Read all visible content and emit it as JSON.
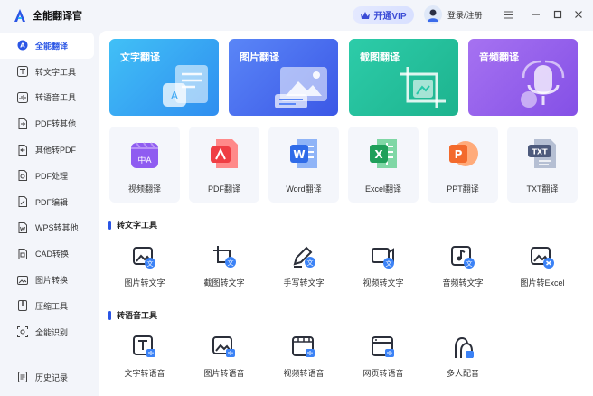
{
  "app": {
    "title": "全能翻译官"
  },
  "header": {
    "vip_label": "开通VIP",
    "login_label": "登录/注册"
  },
  "sidebar": {
    "items": [
      {
        "label": "全能翻译",
        "icon": "translate-icon"
      },
      {
        "label": "转文字工具",
        "icon": "text-tool-icon"
      },
      {
        "label": "转语音工具",
        "icon": "voice-tool-icon"
      },
      {
        "label": "PDF转其他",
        "icon": "pdf-convert-icon"
      },
      {
        "label": "其他转PDF",
        "icon": "to-pdf-icon"
      },
      {
        "label": "PDF处理",
        "icon": "pdf-process-icon"
      },
      {
        "label": "PDF编辑",
        "icon": "pdf-edit-icon"
      },
      {
        "label": "WPS转其他",
        "icon": "wps-icon"
      },
      {
        "label": "CAD转换",
        "icon": "cad-icon"
      },
      {
        "label": "图片转换",
        "icon": "image-convert-icon"
      },
      {
        "label": "压缩工具",
        "icon": "compress-icon"
      },
      {
        "label": "全能识别",
        "icon": "recognize-icon"
      }
    ],
    "bottom_label": "历史记录"
  },
  "big_cards": [
    {
      "label": "文字翻译",
      "color_from": "#3fb9f4",
      "color_to": "#2f8ef0"
    },
    {
      "label": "图片翻译",
      "color_from": "#4f7ef6",
      "color_to": "#3e5ae8"
    },
    {
      "label": "截图翻译",
      "color_from": "#27c7a8",
      "color_to": "#1eb38f"
    },
    {
      "label": "音频翻译",
      "color_from": "#a36cf0",
      "color_to": "#8450e6"
    }
  ],
  "file_cards": [
    {
      "label": "视频翻译",
      "icon": "video-translate-icon"
    },
    {
      "label": "PDF翻译",
      "icon": "pdf-translate-icon"
    },
    {
      "label": "Word翻译",
      "icon": "word-translate-icon"
    },
    {
      "label": "Excel翻译",
      "icon": "excel-translate-icon"
    },
    {
      "label": "PPT翻译",
      "icon": "ppt-translate-icon"
    },
    {
      "label": "TXT翻译",
      "icon": "txt-translate-icon"
    }
  ],
  "sections": {
    "text_tools": {
      "title": "转文字工具",
      "items": [
        "图片转文字",
        "截图转文字",
        "手写转文字",
        "视频转文字",
        "音频转文字",
        "图片转Excel"
      ]
    },
    "voice_tools": {
      "title": "转语音工具",
      "items": [
        "文字转语音",
        "图片转语音",
        "视频转语音",
        "网页转语音",
        "多人配音"
      ]
    }
  },
  "icons": {
    "file_badges": {
      "word": "W",
      "excel": "X",
      "ppt": "P",
      "txt": "TXT",
      "video": "中A"
    }
  }
}
